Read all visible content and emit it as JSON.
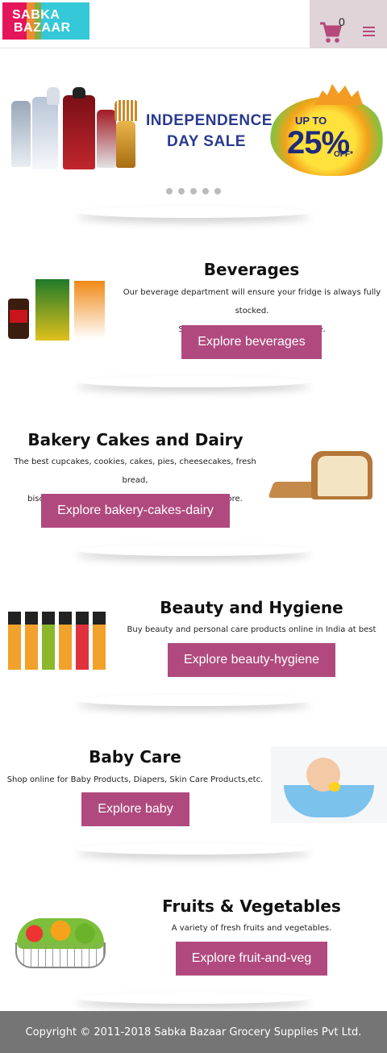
{
  "header": {
    "logo_line1": "SABKA",
    "logo_line2": "BAZAAR",
    "cart_count": "0",
    "cart_icon": "cart-icon",
    "menu_icon": "hamburger-menu-icon"
  },
  "banner": {
    "title_line1": "INDEPENDENCE",
    "title_line2": "DAY SALE",
    "offer_upto": "UP TO",
    "offer_percent": "25%",
    "offer_off": "OFF*",
    "slide_count": 5
  },
  "categories": [
    {
      "title": "Beverages",
      "desc_line1": "Our beverage department will ensure your fridge is always fully stocked.",
      "desc_line2": "Shop for soda, juice, beer and more.",
      "button": "Explore beverages"
    },
    {
      "title": "Bakery Cakes and Dairy",
      "desc_line1": "The best cupcakes, cookies, cakes, pies, cheesecakes, fresh bread,",
      "desc_line2": "biscotti, muffins, bagels, fresh coffee, milk and more.",
      "button": "Explore bakery-cakes-dairy"
    },
    {
      "title": "Beauty and Hygiene",
      "desc_line1": "Buy beauty and personal care products online in India at best prices.",
      "button": "Explore beauty-hygiene"
    },
    {
      "title": "Baby Care",
      "desc_line1": "Shop online for Baby Products, Diapers, Skin Care Products,etc.",
      "button": "Explore baby"
    },
    {
      "title": "Fruits & Vegetables",
      "desc_line1": "A variety of fresh fruits and vegetables.",
      "button": "Explore fruit-and-veg"
    }
  ],
  "footer": {
    "copyright": "Copyright © 2011-2018 Sabka Bazaar Grocery Supplies Pvt Ltd."
  },
  "colors": {
    "accent": "#b04a7e",
    "cart_bg": "#e0d4d8",
    "footer_bg": "#757575"
  }
}
